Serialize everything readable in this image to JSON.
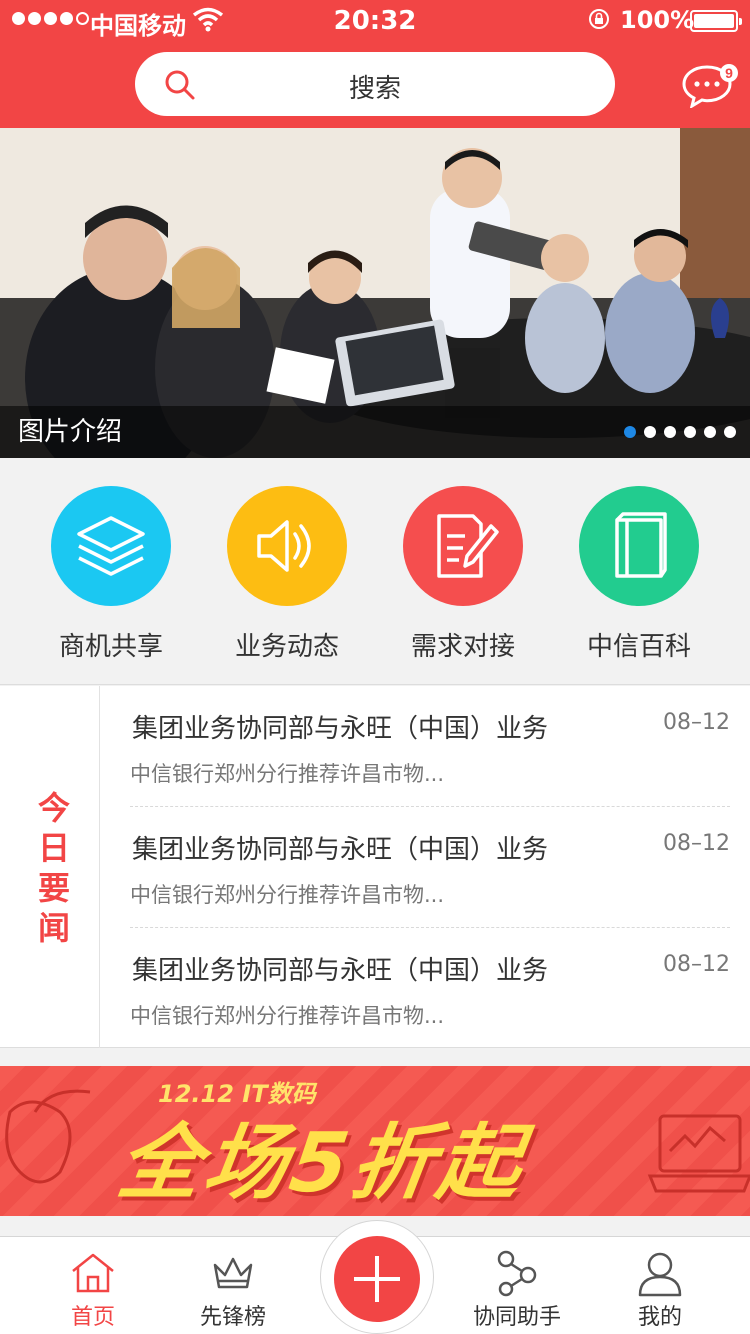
{
  "status_bar": {
    "carrier": "中国移动",
    "time": "20:32",
    "battery": "100%"
  },
  "header": {
    "search_placeholder": "搜索",
    "message_badge": "9"
  },
  "banner": {
    "caption": "图片介绍",
    "page_count": 6,
    "active_index": 0
  },
  "categories": [
    {
      "label": "商机共享",
      "color": "#1bc8f2",
      "icon": "layers-icon"
    },
    {
      "label": "业务动态",
      "color": "#fdbd12",
      "icon": "speaker-icon"
    },
    {
      "label": "需求对接",
      "color": "#f54e4e",
      "icon": "document-edit-icon"
    },
    {
      "label": "中信百科",
      "color": "#22cc8f",
      "icon": "book-icon"
    }
  ],
  "news": {
    "section_label": "今日要闻",
    "items": [
      {
        "title": "集团业务协同部与永旺（中国）业务",
        "date": "08–12",
        "summary": "中信银行郑州分行推荐许昌市物..."
      },
      {
        "title": "集团业务协同部与永旺（中国）业务",
        "date": "08–12",
        "summary": "中信银行郑州分行推荐许昌市物..."
      },
      {
        "title": "集团业务协同部与永旺（中国）业务",
        "date": "08–12",
        "summary": "中信银行郑州分行推荐许昌市物..."
      }
    ]
  },
  "ad": {
    "top_line": "12.12 IT数码",
    "main_line": "全场5折起"
  },
  "tabbar": {
    "home": "首页",
    "ranking": "先锋榜",
    "assistant": "协同助手",
    "mine": "我的"
  },
  "accent_color": "#f24545"
}
